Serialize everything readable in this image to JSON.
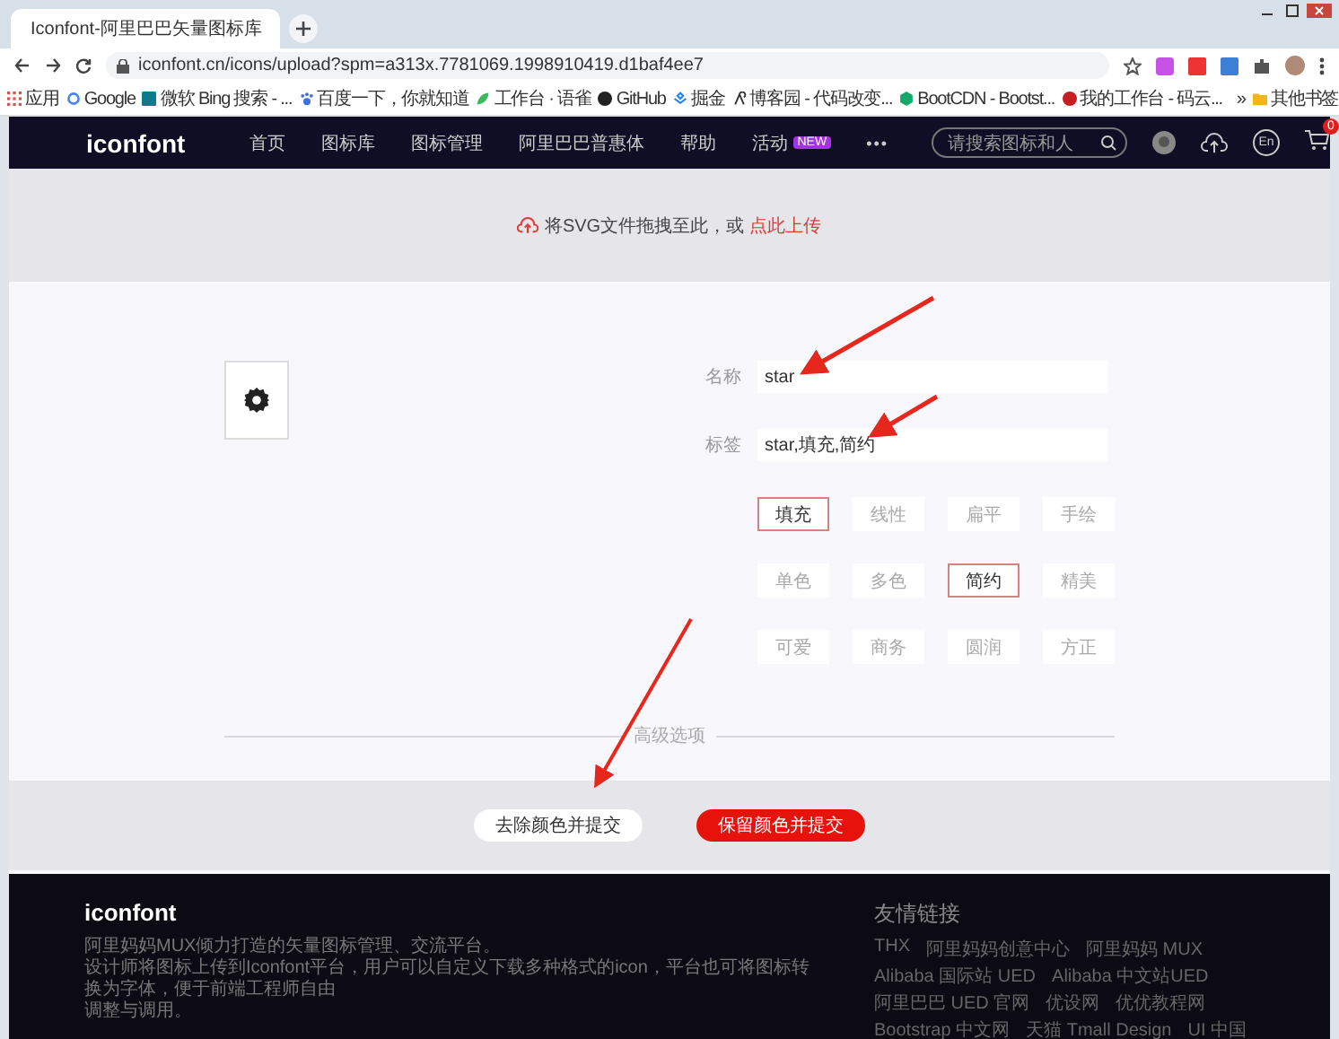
{
  "browser": {
    "tab_title": "Iconfont-阿里巴巴矢量图标库",
    "url": "iconfont.cn/icons/upload?spm=a313x.7781069.1998910419.d1baf4ee7",
    "bookmarks": [
      {
        "kind": "apps",
        "label": "应用"
      },
      {
        "kind": "google",
        "label": "Google"
      },
      {
        "kind": "bing",
        "label": "微软 Bing 搜索 - ..."
      },
      {
        "kind": "paw",
        "label": "百度一下，你就知道"
      },
      {
        "kind": "leaf",
        "label": "工作台 · 语雀"
      },
      {
        "kind": "github",
        "label": "GitHub"
      },
      {
        "kind": "juejin",
        "label": "掘金"
      },
      {
        "kind": "blog",
        "label": "博客园 - 代码改变..."
      },
      {
        "kind": "hex",
        "label": "BootCDN - Bootst..."
      },
      {
        "kind": "gitee",
        "label": "我的工作台 - 码云..."
      }
    ],
    "more_bookmarks": "»",
    "other_bookmarks": "其他书签"
  },
  "nav": {
    "logo": "iconfont",
    "items": [
      {
        "label": "首页"
      },
      {
        "label": "图标库"
      },
      {
        "label": "图标管理"
      },
      {
        "label": "阿里巴巴普惠体"
      },
      {
        "label": "帮助"
      },
      {
        "label": "活动",
        "badge": "NEW"
      }
    ],
    "more": "•••",
    "search": {
      "placeholder": "请搜索图标和人"
    },
    "language": "En",
    "cart_count": "0"
  },
  "upload": {
    "text": "将SVG文件拖拽至此，或",
    "link": "点此上传"
  },
  "form": {
    "name": {
      "label": "名称",
      "value": "star"
    },
    "tags": {
      "label": "标签",
      "value": "star,填充,简约"
    },
    "tag_options": [
      {
        "label": "填充",
        "selected": true
      },
      {
        "label": "线性",
        "selected": false
      },
      {
        "label": "扁平",
        "selected": false
      },
      {
        "label": "手绘",
        "selected": false
      },
      {
        "label": "单色",
        "selected": false
      },
      {
        "label": "多色",
        "selected": false
      },
      {
        "label": "简约",
        "selected": true
      },
      {
        "label": "精美",
        "selected": false
      },
      {
        "label": "可爱",
        "selected": false
      },
      {
        "label": "商务",
        "selected": false
      },
      {
        "label": "圆润",
        "selected": false
      },
      {
        "label": "方正",
        "selected": false
      }
    ],
    "advanced": "高级选项"
  },
  "actions": [
    {
      "kind": "secondary",
      "label": "去除颜色并提交"
    },
    {
      "kind": "primary",
      "label": "保留颜色并提交"
    }
  ],
  "footer": {
    "logo": "iconfont",
    "description": [
      "阿里妈妈MUX倾力打造的矢量图标管理、交流平台。",
      "设计师将图标上传到Iconfont平台，用户可以自定义下载多种格式的icon，平台也可将图标转换为字体，便于前端工程师自由",
      "调整与调用。"
    ],
    "links_title": "友情链接",
    "links": [
      "THX",
      "阿里妈妈创意中心",
      "阿里妈妈 MUX",
      "Alibaba 国际站 UED",
      "Alibaba 中文站UED",
      "阿里巴巴 UED 官网",
      "优设网",
      "优优教程网",
      "Bootstrap 中文网",
      "天猫 Tmall Design",
      "UI 中国"
    ]
  }
}
